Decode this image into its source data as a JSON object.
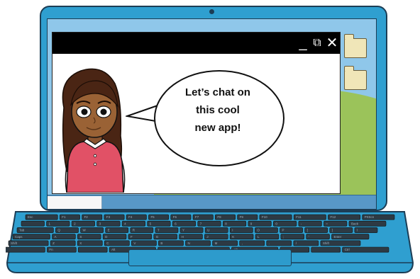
{
  "window_controls": {
    "minimize_glyph": "_",
    "restore_glyph": "⧉",
    "close_glyph": "✕"
  },
  "speech_bubble": {
    "line1": "Let’s chat on",
    "line2": "this cool",
    "line3": "new app!"
  },
  "colors": {
    "laptop_body": "#2f9fd0",
    "outline": "#1c3d55",
    "sky": "#8fc7ea",
    "hill": "#9bc35a",
    "taskbar": "#5898c7",
    "shirt": "#e15166",
    "skin": "#9a6235",
    "hair": "#4a2514"
  },
  "keyboard": {
    "row1": [
      "Esc",
      "F1",
      "F2",
      "F3",
      "F4",
      "F5",
      "F6",
      "F7",
      "F8",
      "F9",
      "F10",
      "F11",
      "F12",
      "PrtScn"
    ],
    "row2": [
      "",
      "1",
      "2",
      "3",
      "4",
      "5",
      "6",
      "7",
      "8",
      "9",
      "0",
      "-",
      "=",
      "Back"
    ],
    "row3": [
      "Tab",
      "Q",
      "W",
      "E",
      "R",
      "T",
      "Y",
      "U",
      "I",
      "O",
      "P",
      "[",
      "]",
      "\\"
    ],
    "row4": [
      "Caps",
      "A",
      "S",
      "D",
      "F",
      "G",
      "H",
      "J",
      "K",
      "L",
      ";",
      "'",
      "Enter"
    ],
    "row5": [
      "Shift",
      "Z",
      "X",
      "C",
      "V",
      "B",
      "N",
      "M",
      ",",
      ".",
      "/",
      "Shift"
    ],
    "row6": [
      "Ctrl",
      "Fn",
      "",
      "Alt",
      "",
      "Alt",
      "",
      "",
      "Ctrl"
    ]
  }
}
